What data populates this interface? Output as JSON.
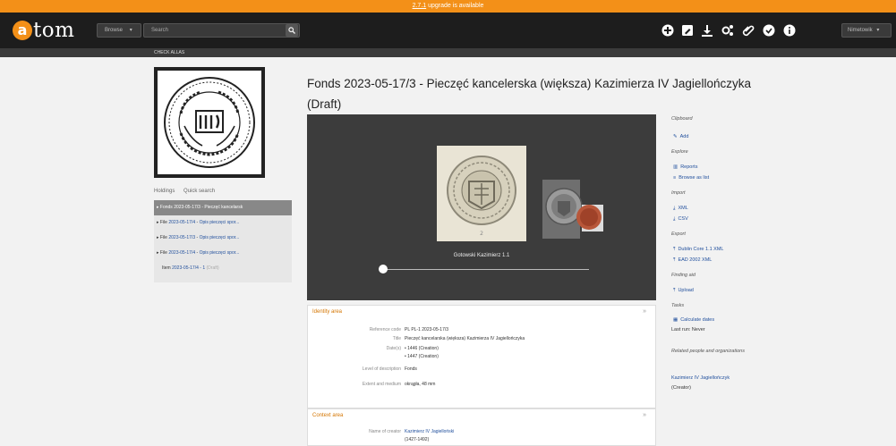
{
  "upgrade": {
    "version": "2.7.1",
    "message": "upgrade is available"
  },
  "header": {
    "logo_letter": "a",
    "logo_text": "tom",
    "browse_label": "Browse",
    "search_placeholder": "Search",
    "language_label": "Nimetowik"
  },
  "subbar": {
    "label": "CHECK ALLAS"
  },
  "sidebar": {
    "tabs": [
      "Holdings",
      "Quick search"
    ],
    "tree": [
      {
        "prefix": "Fonds",
        "ref": "2023-05-17/3",
        "title": "Pieczęć kancelarsk",
        "active": true
      },
      {
        "prefix": "File",
        "ref": "2023-05-17/4",
        "title": "Opis pieczęci spor...",
        "active": false
      },
      {
        "prefix": "File",
        "ref": "2023-05-17/3",
        "title": "Opis pieczęci spor...",
        "active": false
      },
      {
        "prefix": "File",
        "ref": "2023-05-17/4",
        "title": "Opis pieczęci spor...",
        "active": false
      },
      {
        "prefix": "Item",
        "ref": "2023-05-17/4 - 1",
        "title": "(Draft)",
        "active": false
      }
    ]
  },
  "main": {
    "title": "Fonds 2023-05-17/3 - Pieczęć kancelerska (większa) Kazimierza IV Jagiellończyka (Draft)",
    "viewer_caption": "Gotowski Kazimierz 1.1"
  },
  "identity": {
    "heading": "Identity area",
    "fields": [
      {
        "label": "Reference code",
        "value": "PL PL-1 2023-05-17/3"
      },
      {
        "label": "Title",
        "value": "Pieczęć kancelarska (większa) Kazimierza IV Jagiellończyka"
      },
      {
        "label": "Date(s)",
        "value": "• 1446 (Creation)"
      },
      {
        "label": "",
        "value": "• 1447 (Creation)"
      },
      {
        "label": "Level of description",
        "value": "Fonds"
      },
      {
        "label": "Extent and medium",
        "value": "okrągła, 48 mm"
      }
    ]
  },
  "context": {
    "heading": "Context area",
    "creator_label": "Name of creator",
    "creator_name": "Kazimierz IV Jagielloński",
    "creator_dates": "(1427-1492)"
  },
  "rightbar": {
    "clipboard": "Clipboard",
    "add": "Add",
    "explore": "Explore",
    "reports": "Reports",
    "browse_list": "Browse as list",
    "import": "Import",
    "xml": "XML",
    "csv": "CSV",
    "export": "Export",
    "dublin": "Dublin Core 1.1 XML",
    "ead": "EAD 2002 XML",
    "finding_aid": "Finding aid",
    "upload": "Upload",
    "tasks": "Tasks",
    "calculate": "Calculate dates",
    "last_run": "Last run: Never",
    "related": "Related people and organizations",
    "creator": "Kazimierz IV Jagiellończyk",
    "creator_role": "(Creator)"
  }
}
